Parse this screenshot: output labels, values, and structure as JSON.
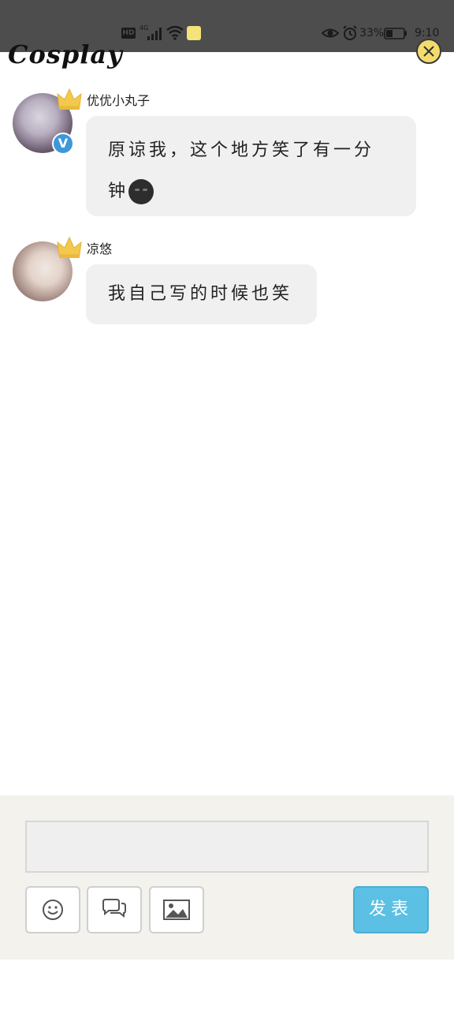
{
  "status_bar": {
    "hd": "HD",
    "network": "4G",
    "battery_percent": "33%",
    "time": "9:10"
  },
  "app": {
    "title": "Cosplay"
  },
  "messages": [
    {
      "username": "优优小丸子",
      "text": "原谅我，这个地方笑了有一分钟",
      "verified": true,
      "emoji": "smirk-emoji"
    },
    {
      "username": "凉悠",
      "text": "我自己写的时候也笑",
      "verified": false
    }
  ],
  "composer": {
    "input_value": "",
    "input_placeholder": "",
    "send_label": "发表",
    "tools": [
      "emoji-icon",
      "chat-icon",
      "image-icon"
    ]
  },
  "colors": {
    "status_bar_bg": "#4d4d4d",
    "bubble_bg": "#f0f0f0",
    "composer_bg": "#f3f2ed",
    "send_button": "#5bc0e3",
    "verified_badge": "#3e97d8",
    "crown": "#f2c94c"
  }
}
